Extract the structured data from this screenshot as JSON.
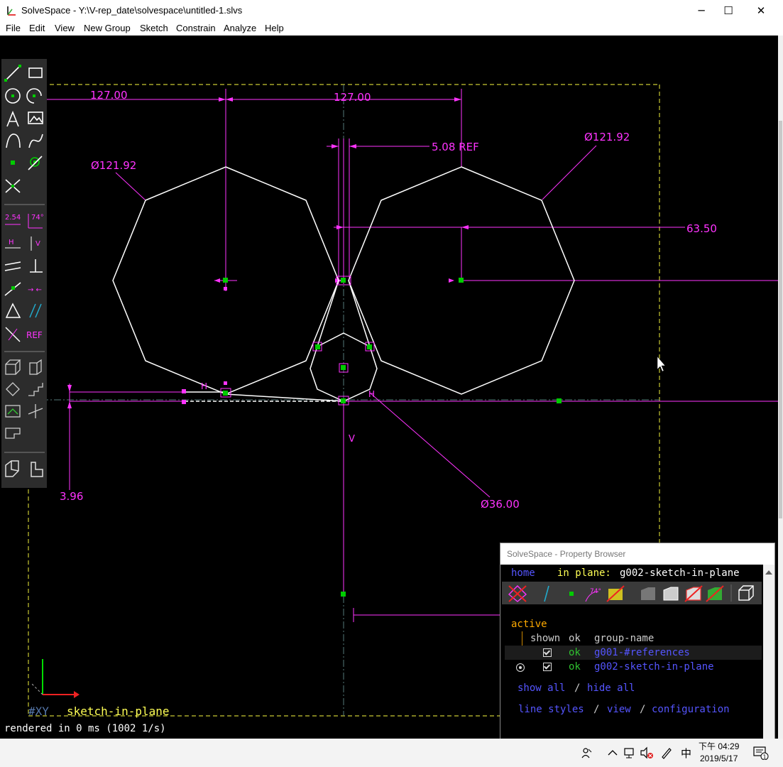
{
  "window": {
    "title": "SolveSpace - Y:\\V-rep_date\\solvespace\\untitled-1.slvs",
    "minimize_glyph": "─",
    "maximize_glyph": "☐",
    "close_glyph": "✕"
  },
  "menu": [
    "File",
    "Edit",
    "View",
    "New Group",
    "Sketch",
    "Constrain",
    "Analyze",
    "Help"
  ],
  "toolbar": {
    "label_dim": "2.54",
    "label_angle": "74°",
    "label_h": "H",
    "label_v": "V",
    "label_ref": "REF"
  },
  "canvas": {
    "dimensions": {
      "d1": "127.00",
      "d2": "127.00",
      "d3": "5.08  REF",
      "d4": "Ø121.92",
      "d5": "Ø121.92",
      "d6": "63.50",
      "d7": "3.96",
      "d8": "Ø36.00"
    },
    "constraint_h1": "H",
    "constraint_h2": "H",
    "constraint_v": "V",
    "axis_label": "#XY",
    "group_label": "sketch-in-plane",
    "status": "rendered in 0 ms (1002 1/s)"
  },
  "colors": {
    "constraint": "#ff33ff",
    "point": "#00cc00",
    "line": "#ffffff",
    "workplane": "#c8c832",
    "group_text": "#ffff55",
    "link": "#5555ff",
    "ok": "#30c030"
  },
  "property_browser": {
    "title": "SolveSpace - Property Browser",
    "home": "home",
    "in_plane_label": "in plane:",
    "in_plane_value": "g002-sketch-in-plane",
    "active": "active",
    "col_shown": "shown",
    "col_ok": "ok",
    "col_group": "group-name",
    "rows": [
      {
        "ok": "ok",
        "name": "g001-#references",
        "shown": true
      },
      {
        "ok": "ok",
        "name": "g002-sketch-in-plane",
        "shown": true
      }
    ],
    "show_all": "show all",
    "slash1": "/",
    "hide_all": "hide all",
    "line_styles": "line styles",
    "slash2": "/",
    "view": "view",
    "slash3": "/",
    "configuration": "configuration"
  },
  "taskbar": {
    "ime": "中",
    "time": "下午 04:29",
    "date": "2019/5/17",
    "notifications": "1"
  }
}
